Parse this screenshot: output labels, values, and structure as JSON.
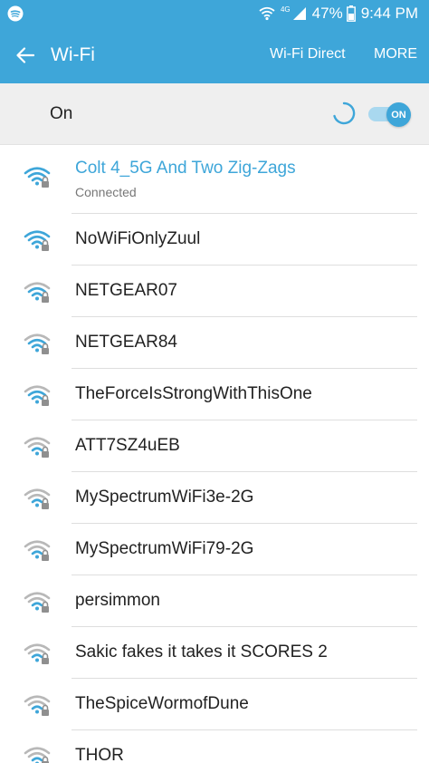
{
  "status_bar": {
    "left_icon": "spotify-icon",
    "network_label": "4G",
    "battery": "47%",
    "time": "9:44 PM"
  },
  "app_bar": {
    "back_icon": "arrow-left-icon",
    "title": "Wi-Fi",
    "action_direct": "Wi-Fi Direct",
    "action_more": "MORE"
  },
  "master_switch": {
    "label": "On",
    "toggle_text": "ON",
    "state": true
  },
  "colors": {
    "accent": "#3ea6d9",
    "signal_strong": "#3ea6d9",
    "signal_weak": "#b8b8b8"
  },
  "networks": [
    {
      "name": "Colt 4_5G And Two Zig-Zags",
      "status": "Connected",
      "signal_level": 4,
      "locked": true
    },
    {
      "name": "NoWiFiOnlyZuul",
      "signal_level": 4,
      "locked": true
    },
    {
      "name": "NETGEAR07",
      "signal_level": 3,
      "locked": true
    },
    {
      "name": "NETGEAR84",
      "signal_level": 3,
      "locked": true
    },
    {
      "name": "TheForceIsStrongWithThisOne",
      "signal_level": 3,
      "locked": true
    },
    {
      "name": "ATT7SZ4uEB",
      "signal_level": 2,
      "locked": true
    },
    {
      "name": "MySpectrumWiFi3e-2G",
      "signal_level": 2,
      "locked": true
    },
    {
      "name": "MySpectrumWiFi79-2G",
      "signal_level": 2,
      "locked": true
    },
    {
      "name": "persimmon",
      "signal_level": 2,
      "locked": true
    },
    {
      "name": "Sakic fakes it takes it SCORES 2",
      "signal_level": 2,
      "locked": true
    },
    {
      "name": "TheSpiceWormofDune",
      "signal_level": 2,
      "locked": true
    },
    {
      "name": "THOR",
      "signal_level": 2,
      "locked": true
    }
  ]
}
